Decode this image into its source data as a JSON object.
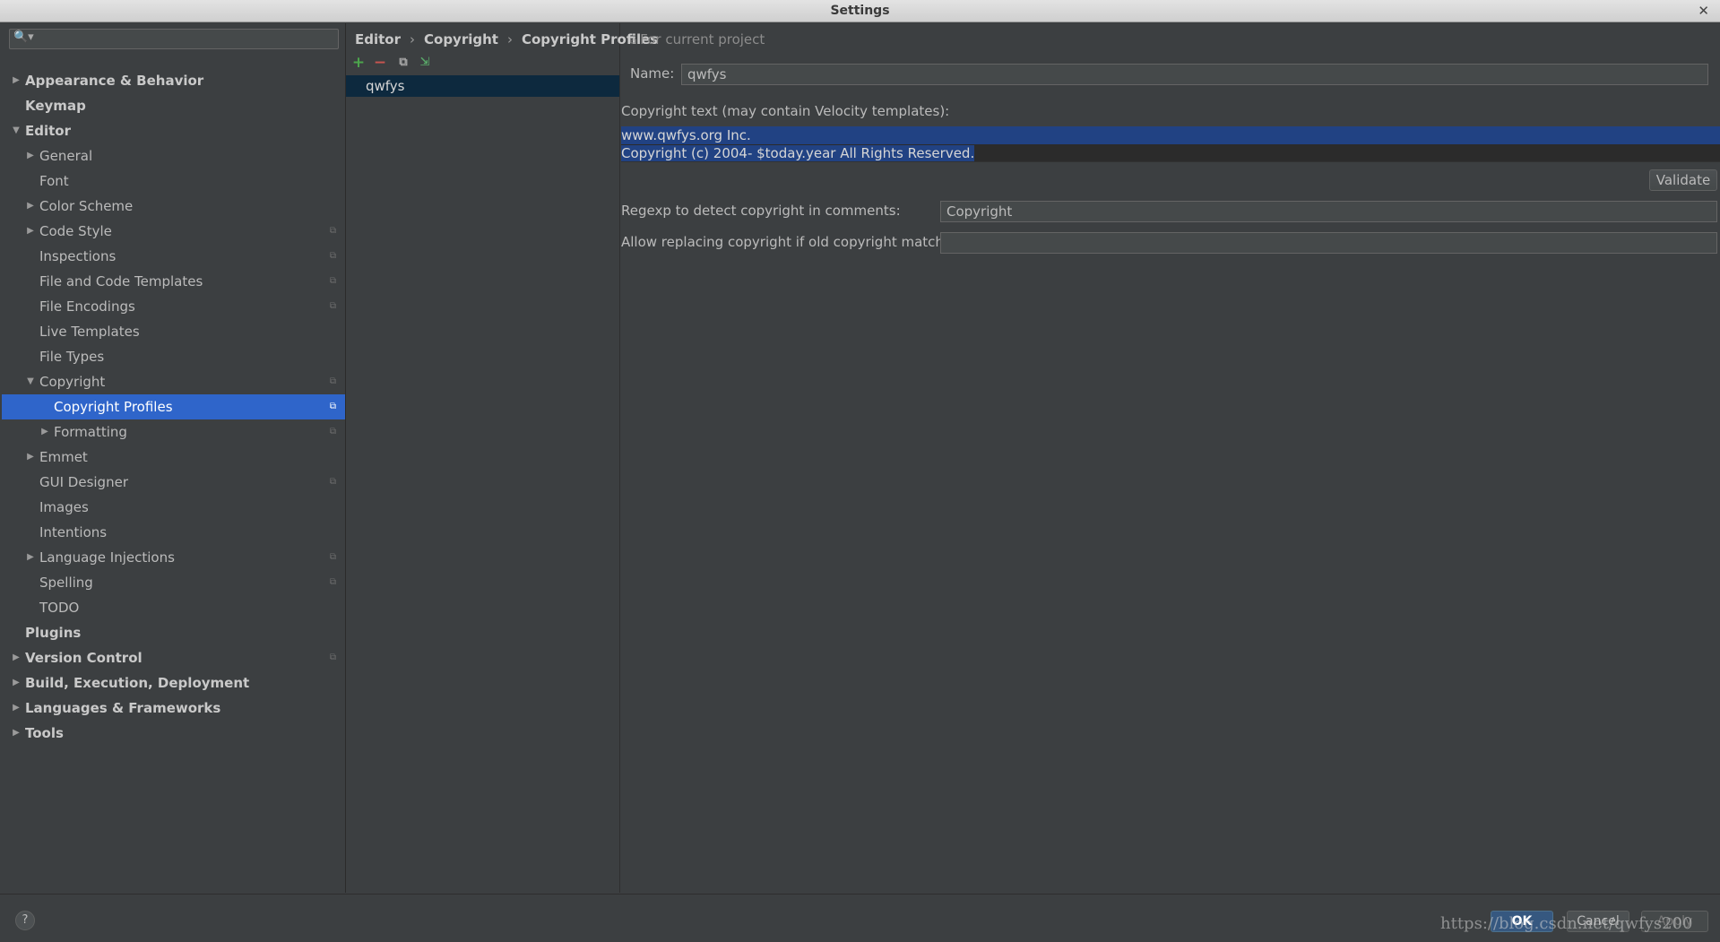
{
  "window": {
    "title": "Settings",
    "close_glyph": "✕"
  },
  "search": {
    "icon": "search-icon",
    "placeholder": ""
  },
  "tree": [
    {
      "label": "Appearance & Behavior",
      "level": 0,
      "bold": true,
      "arrow": "right",
      "copy": false
    },
    {
      "label": "Keymap",
      "level": 0,
      "bold": true,
      "arrow": "none",
      "copy": false
    },
    {
      "label": "Editor",
      "level": 0,
      "bold": true,
      "arrow": "down",
      "copy": false
    },
    {
      "label": "General",
      "level": 1,
      "bold": false,
      "arrow": "right",
      "copy": false
    },
    {
      "label": "Font",
      "level": 1,
      "bold": false,
      "arrow": "none",
      "copy": false
    },
    {
      "label": "Color Scheme",
      "level": 1,
      "bold": false,
      "arrow": "right",
      "copy": false
    },
    {
      "label": "Code Style",
      "level": 1,
      "bold": false,
      "arrow": "right",
      "copy": true
    },
    {
      "label": "Inspections",
      "level": 1,
      "bold": false,
      "arrow": "none",
      "copy": true
    },
    {
      "label": "File and Code Templates",
      "level": 1,
      "bold": false,
      "arrow": "none",
      "copy": true
    },
    {
      "label": "File Encodings",
      "level": 1,
      "bold": false,
      "arrow": "none",
      "copy": true
    },
    {
      "label": "Live Templates",
      "level": 1,
      "bold": false,
      "arrow": "none",
      "copy": false
    },
    {
      "label": "File Types",
      "level": 1,
      "bold": false,
      "arrow": "none",
      "copy": false
    },
    {
      "label": "Copyright",
      "level": 1,
      "bold": false,
      "arrow": "down",
      "copy": true
    },
    {
      "label": "Copyright Profiles",
      "level": 2,
      "bold": false,
      "arrow": "none",
      "copy": true,
      "selected": true
    },
    {
      "label": "Formatting",
      "level": 2,
      "bold": false,
      "arrow": "right",
      "copy": true
    },
    {
      "label": "Emmet",
      "level": 1,
      "bold": false,
      "arrow": "right",
      "copy": false
    },
    {
      "label": "GUI Designer",
      "level": 1,
      "bold": false,
      "arrow": "none",
      "copy": true
    },
    {
      "label": "Images",
      "level": 1,
      "bold": false,
      "arrow": "none",
      "copy": false
    },
    {
      "label": "Intentions",
      "level": 1,
      "bold": false,
      "arrow": "none",
      "copy": false
    },
    {
      "label": "Language Injections",
      "level": 1,
      "bold": false,
      "arrow": "right",
      "copy": true
    },
    {
      "label": "Spelling",
      "level": 1,
      "bold": false,
      "arrow": "none",
      "copy": true
    },
    {
      "label": "TODO",
      "level": 1,
      "bold": false,
      "arrow": "none",
      "copy": false
    },
    {
      "label": "Plugins",
      "level": 0,
      "bold": true,
      "arrow": "none",
      "copy": false
    },
    {
      "label": "Version Control",
      "level": 0,
      "bold": true,
      "arrow": "right",
      "copy": true
    },
    {
      "label": "Build, Execution, Deployment",
      "level": 0,
      "bold": true,
      "arrow": "right",
      "copy": false
    },
    {
      "label": "Languages & Frameworks",
      "level": 0,
      "bold": true,
      "arrow": "right",
      "copy": false
    },
    {
      "label": "Tools",
      "level": 0,
      "bold": true,
      "arrow": "right",
      "copy": false
    }
  ],
  "breadcrumb": [
    "Editor",
    "Copyright",
    "Copyright Profiles"
  ],
  "scope_label": "For current project",
  "profiles_toolbar": {
    "add": "+",
    "remove": "−",
    "copy": "⧉",
    "import": "⇲"
  },
  "profiles": [
    "qwfys"
  ],
  "form": {
    "name_label": "Name:",
    "name_value": "qwfys",
    "copyright_text_label": "Copyright text (may contain Velocity templates):",
    "copyright_lines": [
      "www.qwfys.org Inc.",
      "Copyright (c) 2004- $today.year All Rights Reserved."
    ],
    "validate_label": "Validate",
    "regexp_label": "Regexp to detect copyright in comments:",
    "regexp_value": "Copyright",
    "allow_label": "Allow replacing copyright if old copyright matches:",
    "allow_value": ""
  },
  "footer": {
    "help": "?",
    "ok": "OK",
    "cancel": "Cancel",
    "apply": "Apply",
    "watermark": "https://blog.csdn.net/qwfys200"
  },
  "colors": {
    "selection": "#2f65ca",
    "text_selection": "#214283",
    "panel": "#3c3f41"
  }
}
